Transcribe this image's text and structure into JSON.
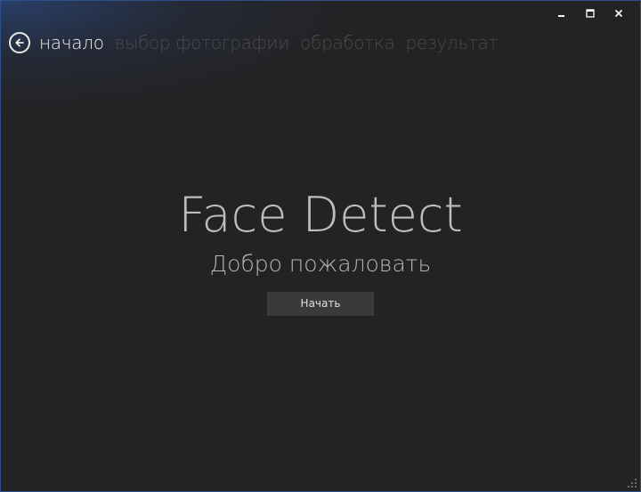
{
  "window": {
    "controls": {
      "minimize_icon": "minimize-icon",
      "maximize_icon": "maximize-icon",
      "close_icon": "close-icon"
    }
  },
  "nav": {
    "back_icon": "arrow-left-icon",
    "steps": [
      {
        "label": "начало",
        "active": true
      },
      {
        "label": "выбор фотографии",
        "active": false
      },
      {
        "label": "обработка",
        "active": false
      },
      {
        "label": "результат",
        "active": false
      }
    ]
  },
  "main": {
    "title": "Face Detect",
    "subtitle": "Добро пожаловать",
    "start_button": "Начать"
  },
  "colors": {
    "background": "#232323",
    "active_text": "#f0f0f0",
    "inactive_text": "#4a4a4a",
    "button_bg": "#3a3a3a",
    "window_border": "#2d4f8a"
  }
}
